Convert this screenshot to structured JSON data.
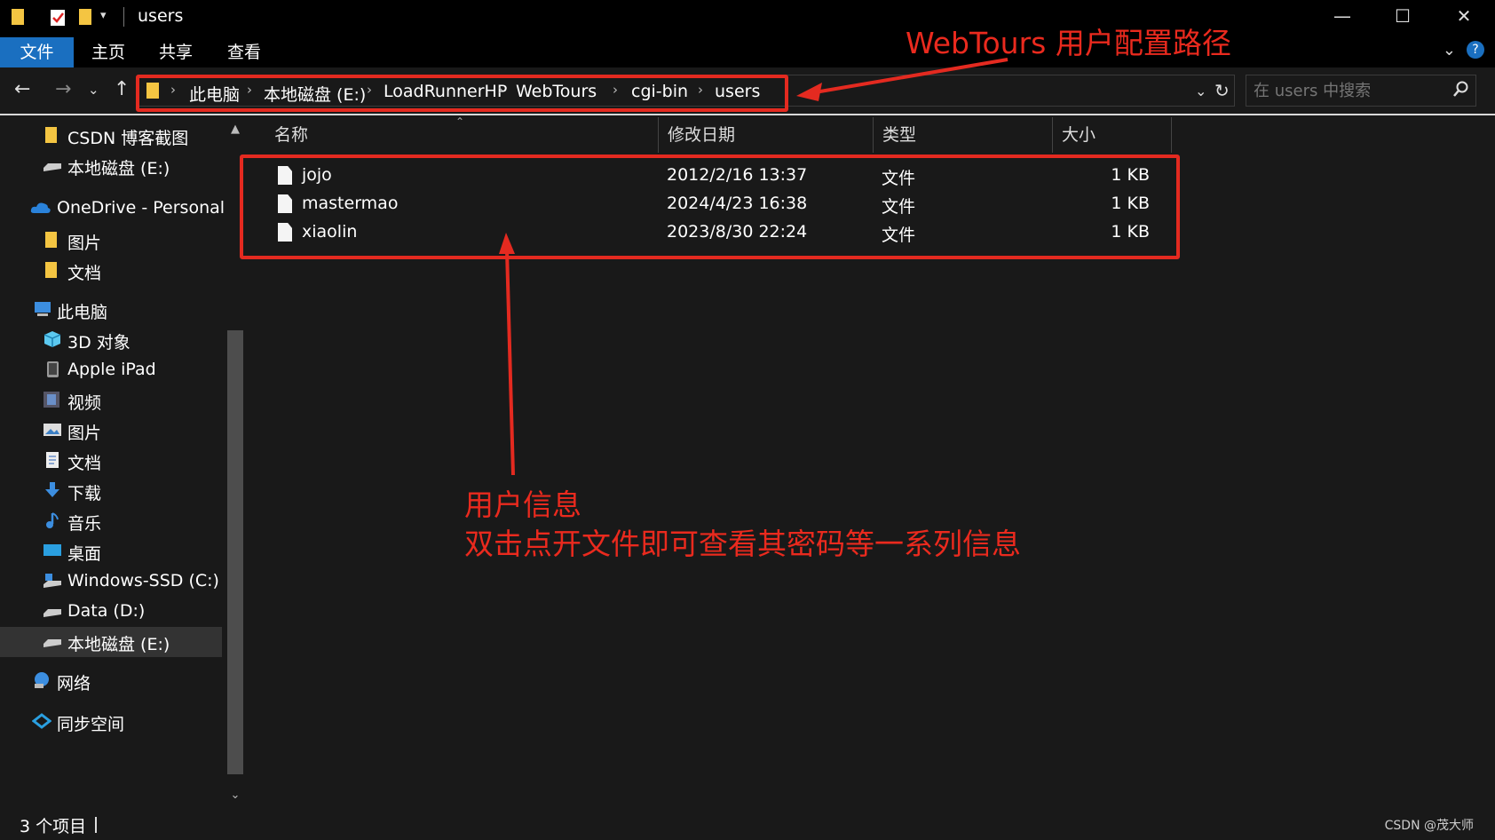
{
  "window": {
    "title": "users",
    "minimize_label": "—",
    "maximize_label": "☐",
    "close_label": "✕"
  },
  "ribbon": {
    "tabs": [
      "文件",
      "主页",
      "共享",
      "查看"
    ],
    "help_label": "?"
  },
  "address": {
    "crumbs": [
      "此电脑",
      "本地磁盘 (E:)",
      "LoadRunnerHP",
      "WebTours",
      "cgi-bin",
      "users"
    ]
  },
  "search": {
    "placeholder": "在 users 中搜索"
  },
  "sidebar": {
    "items": [
      {
        "label": "CSDN 博客截图",
        "icon": "folder-icon"
      },
      {
        "label": "本地磁盘 (E:)",
        "icon": "drive-icon"
      },
      {
        "label": "OneDrive - Personal",
        "icon": "cloud-icon"
      },
      {
        "label": "图片",
        "icon": "folder-icon"
      },
      {
        "label": "文档",
        "icon": "folder-icon"
      },
      {
        "label": "此电脑",
        "icon": "computer-icon"
      },
      {
        "label": "3D 对象",
        "icon": "cube-icon"
      },
      {
        "label": "Apple iPad",
        "icon": "device-icon"
      },
      {
        "label": "视频",
        "icon": "video-icon"
      },
      {
        "label": "图片",
        "icon": "picture-icon"
      },
      {
        "label": "文档",
        "icon": "document-icon"
      },
      {
        "label": "下载",
        "icon": "download-icon"
      },
      {
        "label": "音乐",
        "icon": "music-icon"
      },
      {
        "label": "桌面",
        "icon": "desktop-icon"
      },
      {
        "label": "Windows-SSD (C:)",
        "icon": "drive-icon"
      },
      {
        "label": "Data (D:)",
        "icon": "drive-icon"
      },
      {
        "label": "本地磁盘 (E:)",
        "icon": "drive-icon"
      },
      {
        "label": "网络",
        "icon": "network-icon"
      },
      {
        "label": "同步空间",
        "icon": "sync-icon"
      }
    ]
  },
  "table": {
    "columns": [
      "名称",
      "修改日期",
      "类型",
      "大小"
    ],
    "rows": [
      {
        "name": "jojo",
        "date": "2012/2/16 13:37",
        "type": "文件",
        "size": "1 KB"
      },
      {
        "name": "mastermao",
        "date": "2024/4/23 16:38",
        "type": "文件",
        "size": "1 KB"
      },
      {
        "name": "xiaolin",
        "date": "2023/8/30 22:24",
        "type": "文件",
        "size": "1 KB"
      }
    ]
  },
  "status": {
    "count": "3 个项目"
  },
  "watermark": "CSDN @茂大师",
  "annotations": {
    "path_note": "WebTours 用户配置路径",
    "info_title": "用户信息",
    "info_body": "双击点开文件即可查看其密码等一系列信息"
  },
  "colors": {
    "accent": "#1a6fc0",
    "annotation": "#e42a20",
    "background": "#191919"
  }
}
